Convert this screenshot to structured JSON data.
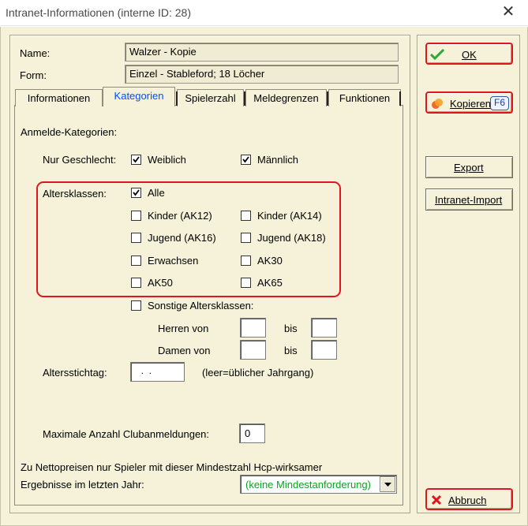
{
  "window": {
    "title": "Intranet-Informationen (interne ID: 28)"
  },
  "fields": {
    "name_label": "Name:",
    "name_value": "Walzer - Kopie",
    "form_label": "Form:",
    "form_value": "Einzel - Stableford; 18 Löcher"
  },
  "tabs": [
    {
      "label": "Informationen"
    },
    {
      "label": "Kategorien",
      "selected": true
    },
    {
      "label": "Spielerzahl"
    },
    {
      "label": "Meldegrenzen"
    },
    {
      "label": "Funktionen"
    }
  ],
  "categories": {
    "heading": "Anmelde-Kategorien:",
    "gender_label": "Nur Geschlecht:",
    "gender": [
      {
        "label": "Weiblich",
        "checked": true
      },
      {
        "label": "Männlich",
        "checked": true
      }
    ],
    "age_label": "Altersklassen:",
    "age_all": {
      "label": "Alle",
      "checked": true
    },
    "age_classes": [
      {
        "label": "Kinder (AK12)",
        "checked": false
      },
      {
        "label": "Kinder (AK14)",
        "checked": false
      },
      {
        "label": "Jugend (AK16)",
        "checked": false
      },
      {
        "label": "Jugend (AK18)",
        "checked": false
      },
      {
        "label": "Erwachsen",
        "checked": false
      },
      {
        "label": "AK30",
        "checked": false
      },
      {
        "label": "AK50",
        "checked": false
      },
      {
        "label": "AK65",
        "checked": false
      }
    ],
    "other": {
      "label": "Sonstige Altersklassen:",
      "checked": false
    },
    "men_label": "Herren von",
    "women_label": "Damen von",
    "bis_label": "bis",
    "men_from": "",
    "men_to": "",
    "women_from": "",
    "women_to": "",
    "cutoff_label": "Altersstichtag:",
    "cutoff_value": "  .  .",
    "cutoff_hint": "(leer=üblicher Jahrgang)",
    "max_label": "Maximale Anzahl Clubanmeldungen:",
    "max_value": "0",
    "net_line1": "Zu Nettopreisen nur Spieler mit dieser Mindestzahl Hcp-wirksamer",
    "net_line2": "Ergebnisse im letzten Jahr:",
    "net_select": "(keine Mindestanforderung)"
  },
  "buttons": {
    "ok": "OK",
    "copy": "Kopieren",
    "copy_key": "F6",
    "export": "Export",
    "import": "Intranet-Import",
    "cancel": "Abbruch"
  },
  "colors": {
    "dialog_bg": "#f5f2d9",
    "highlight_red": "#e0161c",
    "tab_selected": "#0050ff",
    "select_text": "#10a023"
  },
  "icons": [
    "close-icon",
    "checkmark-icon",
    "copy-icon",
    "cancel-icon",
    "dropdown-arrow-icon"
  ]
}
